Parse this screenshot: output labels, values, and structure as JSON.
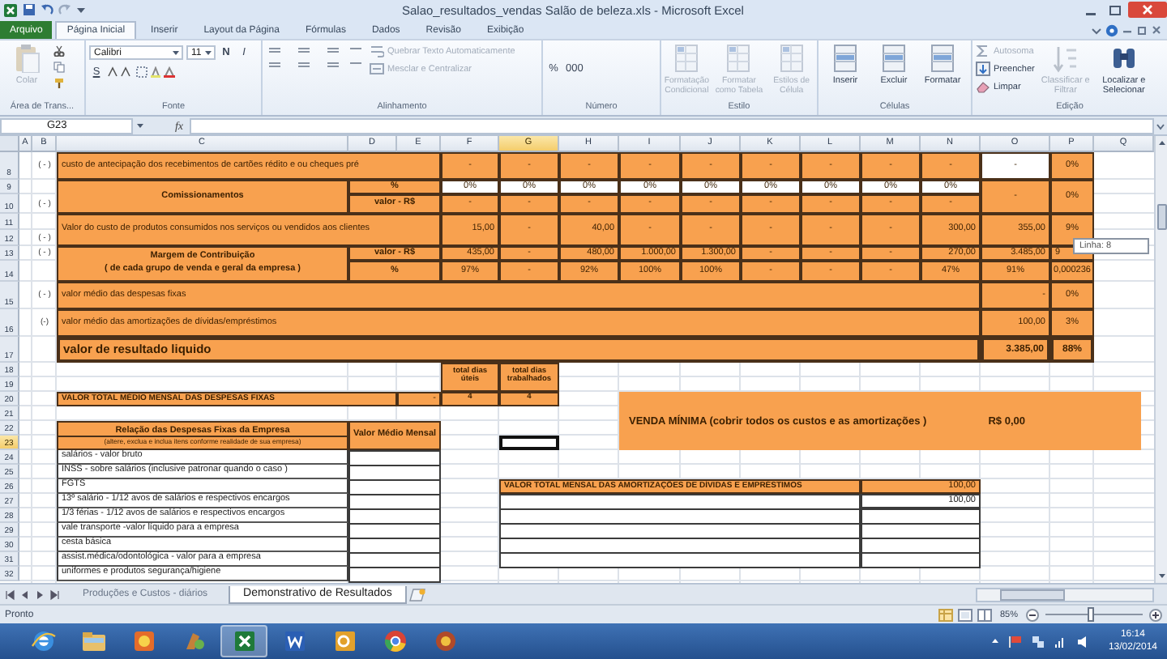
{
  "window": {
    "title": "Salao_resultados_vendas Salão de beleza.xls - Microsoft Excel"
  },
  "tabs": [
    {
      "label": "Arquivo",
      "kind": "file",
      "selected": false
    },
    {
      "label": "Página Inicial",
      "kind": "tab",
      "selected": true
    },
    {
      "label": "Inserir",
      "kind": "tab",
      "selected": false
    },
    {
      "label": "Layout da Página",
      "kind": "tab",
      "selected": false
    },
    {
      "label": "Fórmulas",
      "kind": "tab",
      "selected": false
    },
    {
      "label": "Dados",
      "kind": "tab",
      "selected": false
    },
    {
      "label": "Revisão",
      "kind": "tab",
      "selected": false
    },
    {
      "label": "Exibição",
      "kind": "tab",
      "selected": false
    }
  ],
  "ribbon": [
    {
      "label": "Área de Trans...",
      "items": [
        {
          "kind": "big",
          "label": "Colar",
          "disabled": true
        }
      ]
    },
    {
      "label": "Fonte",
      "items": [
        {
          "kind": "combo",
          "label": "Calibri",
          "disabled": false
        },
        {
          "kind": "combo",
          "label": "11",
          "disabled": false
        },
        {
          "kind": "tool",
          "label": "N",
          "disabled": false
        },
        {
          "kind": "tool",
          "label": "I",
          "disabled": false
        },
        {
          "kind": "tool",
          "label": "S",
          "disabled": false
        }
      ]
    },
    {
      "label": "Alinhamento",
      "items": [
        {
          "kind": "small",
          "label": "Quebrar Texto Automaticamente",
          "disabled": true
        },
        {
          "kind": "small",
          "label": "Mesclar e Centralizar",
          "disabled": true
        }
      ]
    },
    {
      "label": "Número",
      "items": [
        {
          "kind": "tool",
          "label": "%",
          "disabled": false
        },
        {
          "kind": "tool",
          "label": "000",
          "disabled": false
        }
      ]
    },
    {
      "label": "Estilo",
      "items": [
        {
          "kind": "big",
          "label": "Formatação Condicional",
          "disabled": true
        },
        {
          "kind": "big",
          "label": "Formatar como Tabela",
          "disabled": true
        },
        {
          "kind": "big",
          "label": "Estilos de Célula",
          "disabled": true
        }
      ]
    },
    {
      "label": "Células",
      "items": [
        {
          "kind": "big",
          "label": "Inserir",
          "disabled": false
        },
        {
          "kind": "big",
          "label": "Excluir",
          "disabled": false
        },
        {
          "kind": "big",
          "label": "Formatar",
          "disabled": false
        }
      ]
    },
    {
      "label": "Edição",
      "items": [
        {
          "kind": "small",
          "label": "Autosoma",
          "disabled": true
        },
        {
          "kind": "small",
          "label": "Preencher",
          "disabled": false
        },
        {
          "kind": "small",
          "label": "Limpar",
          "disabled": false
        },
        {
          "kind": "big",
          "label": "Classificar e Filtrar",
          "disabled": true
        },
        {
          "kind": "big",
          "label": "Localizar e Selecionar",
          "disabled": false
        }
      ]
    }
  ],
  "formula_bar": {
    "cell_name": "G23",
    "function_label": "fx"
  },
  "columns": [
    {
      "label": "A",
      "selected": false
    },
    {
      "label": "B",
      "selected": false
    },
    {
      "label": "C",
      "selected": false
    },
    {
      "label": "D",
      "selected": false
    },
    {
      "label": "E",
      "selected": false
    },
    {
      "label": "F",
      "selected": false
    },
    {
      "label": "G",
      "selected": true
    },
    {
      "label": "H",
      "selected": false
    },
    {
      "label": "I",
      "selected": false
    },
    {
      "label": "J",
      "selected": false
    },
    {
      "label": "K",
      "selected": false
    },
    {
      "label": "L",
      "selected": false
    },
    {
      "label": "M",
      "selected": false
    },
    {
      "label": "N",
      "selected": false
    },
    {
      "label": "O",
      "selected": false
    },
    {
      "label": "P",
      "selected": false
    },
    {
      "label": "Q",
      "selected": false
    }
  ],
  "rows": [
    {
      "label": "8",
      "selected": false
    },
    {
      "label": "9",
      "selected": false
    },
    {
      "label": "10",
      "selected": false
    },
    {
      "label": "11",
      "selected": false
    },
    {
      "label": "12",
      "selected": false
    },
    {
      "label": "13",
      "selected": false
    },
    {
      "label": "14",
      "selected": false
    },
    {
      "label": "15",
      "selected": false
    },
    {
      "label": "16",
      "selected": false
    },
    {
      "label": "17",
      "selected": false
    },
    {
      "label": "18",
      "selected": false
    },
    {
      "label": "19",
      "selected": false
    },
    {
      "label": "20",
      "selected": false
    },
    {
      "label": "21",
      "selected": false
    },
    {
      "label": "22",
      "selected": false
    },
    {
      "label": "23",
      "selected": true
    },
    {
      "label": "24",
      "selected": false
    },
    {
      "label": "25",
      "selected": false
    },
    {
      "label": "26",
      "selected": false
    },
    {
      "label": "27",
      "selected": false
    },
    {
      "label": "28",
      "selected": false
    },
    {
      "label": "29",
      "selected": false
    },
    {
      "label": "30",
      "selected": false
    },
    {
      "label": "31",
      "selected": false
    },
    {
      "label": "32",
      "selected": false
    }
  ],
  "cells": [
    {
      "text": "( - )",
      "kind": "sign"
    },
    {
      "text": "custo de antecipação dos recebimentos de cartões rédito e ou cheques pré",
      "kind": "band"
    },
    {
      "text": "-",
      "kind": "mid"
    },
    {
      "text": "-",
      "kind": "mid"
    },
    {
      "text": "-",
      "kind": "mid"
    },
    {
      "text": "-",
      "kind": "mid"
    },
    {
      "text": "-",
      "kind": "mid"
    },
    {
      "text": "-",
      "kind": "mid"
    },
    {
      "text": "-",
      "kind": "mid"
    },
    {
      "text": "-",
      "kind": "mid"
    },
    {
      "text": "-",
      "kind": "mid"
    },
    {
      "text": "-",
      "kind": "white"
    },
    {
      "text": "0%",
      "kind": "mid"
    },
    {
      "text": "Comissionamentos",
      "kind": "title"
    },
    {
      "text": "%",
      "kind": "title"
    },
    {
      "text": "0%",
      "kind": "white"
    },
    {
      "text": "0%",
      "kind": "white"
    },
    {
      "text": "0%",
      "kind": "white"
    },
    {
      "text": "0%",
      "kind": "white"
    },
    {
      "text": "0%",
      "kind": "white"
    },
    {
      "text": "0%",
      "kind": "white"
    },
    {
      "text": "0%",
      "kind": "white"
    },
    {
      "text": "0%",
      "kind": "white"
    },
    {
      "text": "0%",
      "kind": "white"
    },
    {
      "text": "-",
      "kind": "mid"
    },
    {
      "text": "0%",
      "kind": "mid"
    },
    {
      "text": "( - )",
      "kind": "sign"
    },
    {
      "text": "valor - R$",
      "kind": "title"
    },
    {
      "text": "-",
      "kind": "mid"
    },
    {
      "text": "-",
      "kind": "mid"
    },
    {
      "text": "-",
      "kind": "mid"
    },
    {
      "text": "-",
      "kind": "mid"
    },
    {
      "text": "-",
      "kind": "mid"
    },
    {
      "text": "-",
      "kind": "mid"
    },
    {
      "text": "-",
      "kind": "mid"
    },
    {
      "text": "-",
      "kind": "mid"
    },
    {
      "text": "-",
      "kind": "mid"
    },
    {
      "text": "Valor do custo de produtos consumidos nos serviços ou vendidos aos clientes",
      "kind": "band"
    },
    {
      "text": "15,00",
      "kind": "num"
    },
    {
      "text": "-",
      "kind": "mid"
    },
    {
      "text": "40,00",
      "kind": "num"
    },
    {
      "text": "-",
      "kind": "mid"
    },
    {
      "text": "-",
      "kind": "mid"
    },
    {
      "text": "-",
      "kind": "mid"
    },
    {
      "text": "-",
      "kind": "mid"
    },
    {
      "text": "-",
      "kind": "mid"
    },
    {
      "text": "300,00",
      "kind": "num"
    },
    {
      "text": "355,00",
      "kind": "num"
    },
    {
      "text": "9%",
      "kind": "mid"
    },
    {
      "text": "( - )",
      "kind": "sign"
    },
    {
      "text": "( - )",
      "kind": "sign"
    },
    {
      "text": "Margem de Contribuição",
      "kind": "title"
    },
    {
      "text": "valor - R$",
      "kind": "title"
    },
    {
      "text": "435,00",
      "kind": "num"
    },
    {
      "text": "-",
      "kind": "mid"
    },
    {
      "text": "480,00",
      "kind": "num"
    },
    {
      "text": "1.000,00",
      "kind": "num"
    },
    {
      "text": "1.300,00",
      "kind": "num"
    },
    {
      "text": "-",
      "kind": "mid"
    },
    {
      "text": "-",
      "kind": "mid"
    },
    {
      "text": "-",
      "kind": "mid"
    },
    {
      "text": "270,00",
      "kind": "num"
    },
    {
      "text": "3.485,00",
      "kind": "num"
    },
    {
      "text": "9",
      "kind": "mid"
    },
    {
      "text": "( de cada grupo de venda e geral da empresa )",
      "kind": "subtitle"
    },
    {
      "text": "%",
      "kind": "title"
    },
    {
      "text": "97%",
      "kind": "mid"
    },
    {
      "text": "-",
      "kind": "mid"
    },
    {
      "text": "92%",
      "kind": "mid"
    },
    {
      "text": "100%",
      "kind": "mid"
    },
    {
      "text": "100%",
      "kind": "mid"
    },
    {
      "text": "-",
      "kind": "mid"
    },
    {
      "text": "-",
      "kind": "mid"
    },
    {
      "text": "-",
      "kind": "mid"
    },
    {
      "text": "47%",
      "kind": "mid"
    },
    {
      "text": "91%",
      "kind": "mid"
    },
    {
      "text": "0,000236",
      "kind": "mid"
    },
    {
      "text": "( - )",
      "kind": "sign"
    },
    {
      "text": "valor médio das despesas fixas",
      "kind": "band"
    },
    {
      "text": "-",
      "kind": "num"
    },
    {
      "text": "0%",
      "kind": "mid"
    },
    {
      "text": "(-)",
      "kind": "sign"
    },
    {
      "text": "valor médio das amortizações de dívidas/empréstimos",
      "kind": "band"
    },
    {
      "text": "100,00",
      "kind": "num"
    },
    {
      "text": "3%",
      "kind": "mid"
    },
    {
      "text": "valor de resultado liquido",
      "kind": "big"
    },
    {
      "text": "3.385,00",
      "kind": "bignum"
    },
    {
      "text": "88%",
      "kind": "bigmid"
    },
    {
      "text": "total dias úteis",
      "kind": "head"
    },
    {
      "text": "total dias trabalhados",
      "kind": "head"
    },
    {
      "text": "VALOR TOTAL MÉDIO MENSAL DAS DESPESAS FIXAS",
      "kind": "caps"
    },
    {
      "text": "-",
      "kind": "num"
    },
    {
      "text": "4",
      "kind": "head"
    },
    {
      "text": "4",
      "kind": "head"
    },
    {
      "text": "Relação das Despesas Fixas da Empresa",
      "kind": "title"
    },
    {
      "text": "(altere, exclua e inclua itens conforme realidade de sua empresa)",
      "kind": "note"
    },
    {
      "text": "Valor Médio Mensal",
      "kind": "title"
    },
    {
      "text": "salários - valor bruto",
      "kind": "item"
    },
    {
      "text": "INSS - sobre salários (inclusive patronar quando o caso )",
      "kind": "item"
    },
    {
      "text": "FGTS",
      "kind": "item"
    },
    {
      "text": "13º salário - 1/12 avos de salários e respectivos encargos",
      "kind": "item"
    },
    {
      "text": "1/3 férias - 1/12 avos de salários e respectivos encargos",
      "kind": "item"
    },
    {
      "text": "vale transporte -valor líquido para a empresa",
      "kind": "item"
    },
    {
      "text": "cesta básica",
      "kind": "item"
    },
    {
      "text": "assist.médica/odontológica - valor para a empresa",
      "kind": "item"
    },
    {
      "text": "uniformes e produtos segurança/higiene",
      "kind": "item"
    },
    {
      "text": "VALOR TOTAL MENSAL DAS AMORTIZAÇÕES DE DÍVIDAS E EMPRÉSTIMOS",
      "kind": "caps"
    },
    {
      "text": "100,00",
      "kind": "num"
    },
    {
      "text": "100,00",
      "kind": "whitenum"
    }
  ],
  "minimum_sale": {
    "label": "VENDA MÍNIMA (cobrir todos os custos e as amortizações )",
    "value": "R$ 0,00"
  },
  "tooltip": {
    "text": "Linha: 8"
  },
  "sheet_tabs": [
    {
      "label": "Produções e Custos - diários",
      "selected": false
    },
    {
      "label": "Demonstrativo de Resultados",
      "selected": true
    }
  ],
  "status_bar": {
    "text": "Pronto",
    "zoom": "85%",
    "zoom_slider": {
      "level": 0.47
    }
  },
  "taskbar": {
    "apps": [
      {
        "selected": false
      },
      {
        "selected": false
      },
      {
        "selected": false
      },
      {
        "selected": false
      },
      {
        "selected": true
      },
      {
        "selected": false
      },
      {
        "selected": false
      },
      {
        "selected": false
      },
      {
        "selected": false
      }
    ],
    "time": "16:14",
    "date": "13/02/2014"
  }
}
